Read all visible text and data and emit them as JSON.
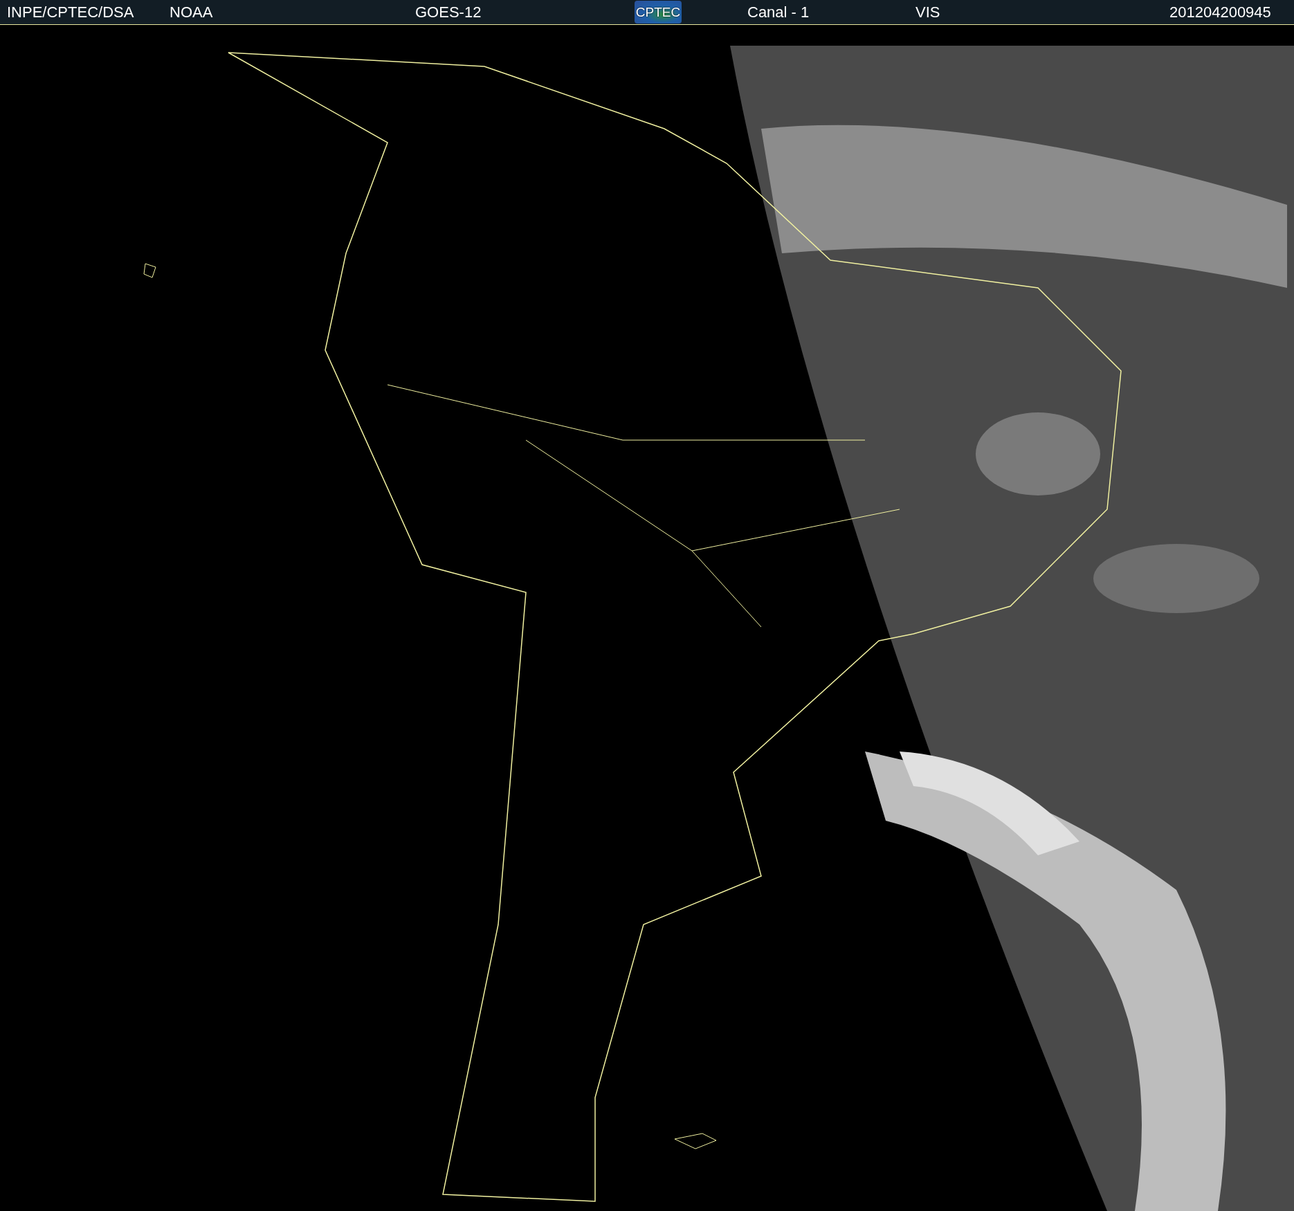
{
  "header": {
    "agency": "INPE/CPTEC/DSA",
    "source": "NOAA",
    "satellite": "GOES-12",
    "logo_text": "CPTEC",
    "channel": "Canal - 1",
    "band": "VIS",
    "timestamp": "201204200945"
  }
}
